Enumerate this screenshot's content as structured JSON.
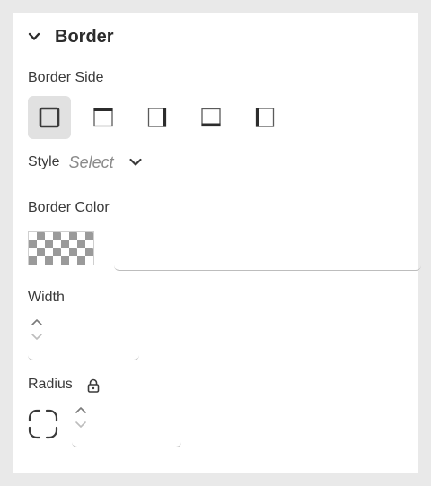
{
  "section": {
    "title": "Border",
    "icon": "chevron-down-icon"
  },
  "border_side": {
    "label": "Border Side",
    "options": [
      {
        "name": "all",
        "icon": "border-all-icon",
        "selected": true
      },
      {
        "name": "top",
        "icon": "border-top-icon",
        "selected": false
      },
      {
        "name": "right",
        "icon": "border-right-icon",
        "selected": false
      },
      {
        "name": "bottom",
        "icon": "border-bottom-icon",
        "selected": false
      },
      {
        "name": "left",
        "icon": "border-left-icon",
        "selected": false
      }
    ]
  },
  "style": {
    "label": "Style",
    "value": "Select"
  },
  "border_color": {
    "label": "Border Color",
    "value": ""
  },
  "width": {
    "label": "Width",
    "value": ""
  },
  "radius": {
    "label": "Radius",
    "value": ""
  },
  "colors": {
    "panel_bg": "#ffffff",
    "page_bg": "#e9e9e9",
    "selected_bg": "#e1e1e1",
    "text": "#2c2c2c"
  }
}
